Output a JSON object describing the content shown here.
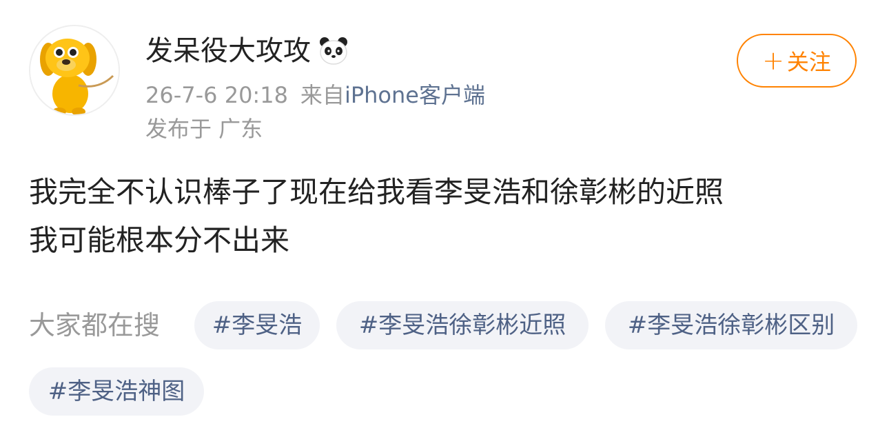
{
  "post": {
    "user": {
      "name": "发呆役大攻攻",
      "badge_icon": "panda-icon",
      "avatar_icon": "yellow-dog-avatar-icon"
    },
    "meta": {
      "timestamp": "26-7-6 20:18",
      "source_prefix": "来自",
      "source": "iPhone客户端",
      "location": "发布于 广东"
    },
    "follow_button": {
      "plus": "+",
      "label": "关注"
    },
    "content": {
      "line1": "我完全不认识棒子了现在给我看李旻浩和徐彰彬的近照",
      "line2": "我可能根本分不出来"
    },
    "search": {
      "label": "大家都在搜",
      "tags": [
        "#李旻浩",
        "#李旻浩徐彰彬近照",
        "#李旻浩徐彰彬区别",
        "#李旻浩神图"
      ]
    },
    "colors": {
      "accent": "#ff8200",
      "link": "#5e7291",
      "tag_text": "#4e6185",
      "tag_bg": "#f2f3f7",
      "muted": "#999999"
    }
  }
}
